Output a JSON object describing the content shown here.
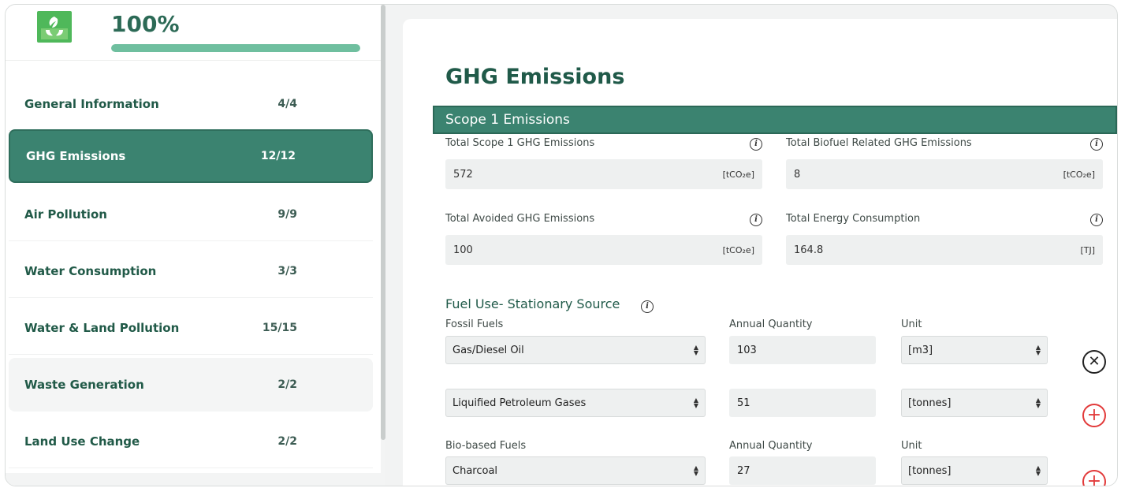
{
  "progress": {
    "percent_label": "100%",
    "fraction": 1.0
  },
  "sidebar": {
    "items": [
      {
        "label": "General Information",
        "count": "4/4",
        "state": "normal"
      },
      {
        "label": "GHG Emissions",
        "count": "12/12",
        "state": "active"
      },
      {
        "label": "Air Pollution",
        "count": "9/9",
        "state": "normal"
      },
      {
        "label": "Water Consumption",
        "count": "3/3",
        "state": "normal"
      },
      {
        "label": "Water & Land Pollution",
        "count": "15/15",
        "state": "normal"
      },
      {
        "label": "Waste Generation",
        "count": "2/2",
        "state": "hover"
      },
      {
        "label": "Land Use Change",
        "count": "2/2",
        "state": "normal"
      }
    ]
  },
  "main": {
    "title": "GHG Emissions",
    "scope_section": "Scope 1 Emissions",
    "fields": [
      {
        "label": "Total Scope 1 GHG Emissions",
        "value": "572",
        "unit": "[tCO₂e]"
      },
      {
        "label": "Total Biofuel Related GHG Emissions",
        "value": "8",
        "unit": "[tCO₂e]"
      },
      {
        "label": "Total Avoided GHG Emissions",
        "value": "100",
        "unit": "[tCO₂e]"
      },
      {
        "label": "Total Energy Consumption",
        "value": "164.8",
        "unit": "[TJ]"
      }
    ],
    "fuel_section": {
      "title": "Fuel Use- Stationary Source",
      "headers": {
        "fossil": "Fossil Fuels",
        "quantity": "Annual Quantity",
        "unit": "Unit"
      },
      "bio_headers": {
        "bio": "Bio-based Fuels",
        "quantity": "Annual Quantity",
        "unit": "Unit"
      },
      "rows": [
        {
          "fuel": "Gas/Diesel Oil",
          "quantity": "103",
          "unit": "[m3]",
          "action": "remove"
        },
        {
          "fuel": "Liquified Petroleum Gases",
          "quantity": "51",
          "unit": "[tonnes]",
          "action": "add"
        },
        {
          "fuel": "Charcoal",
          "quantity": "27",
          "unit": "[tonnes]",
          "action": "add"
        }
      ]
    }
  },
  "icons": {
    "logo": "leaf-recycle-icon",
    "info": "info-icon",
    "remove": "close-circle-icon",
    "add": "plus-circle-icon",
    "select": "select-arrows-icon"
  },
  "colors": {
    "brand_green": "#3b8370",
    "title_green": "#205a49",
    "progress_fill": "#6fbf9f",
    "logo_green": "#4fb85a",
    "add_red": "#e23a3a"
  }
}
